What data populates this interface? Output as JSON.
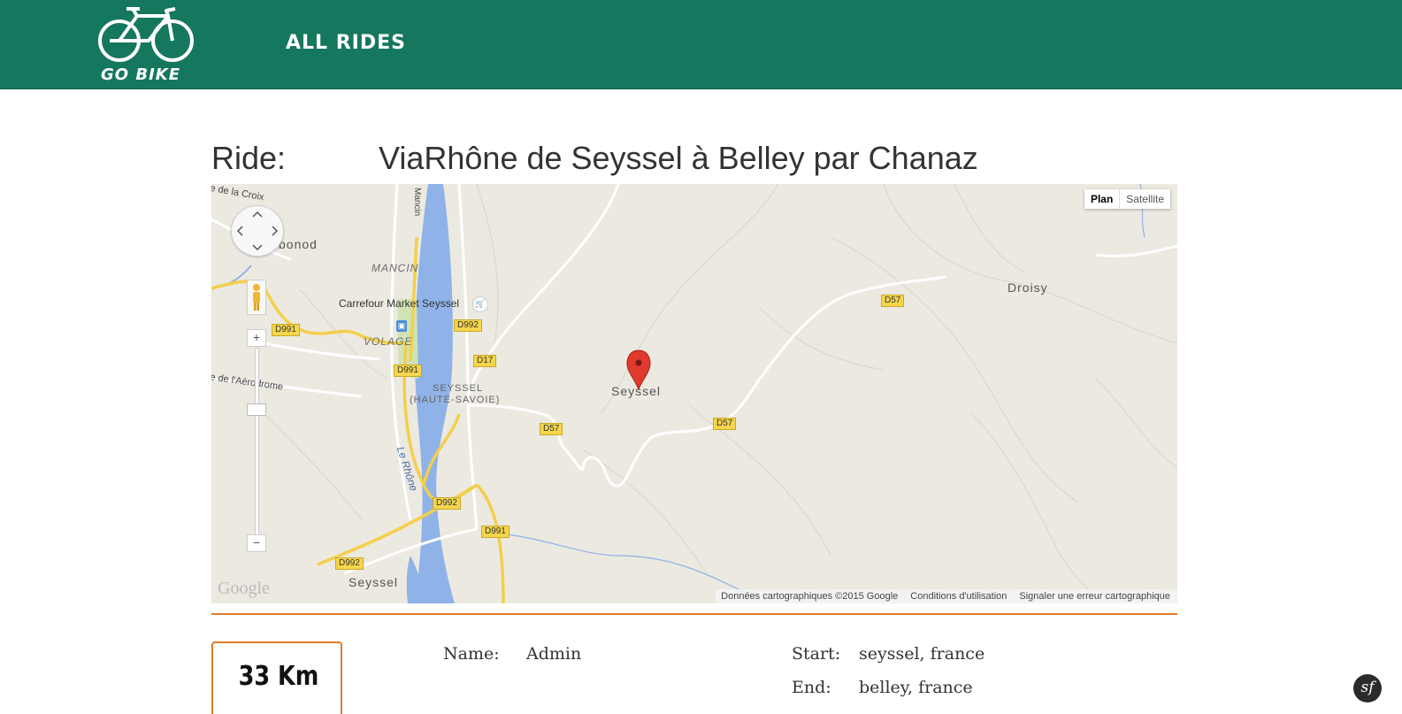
{
  "header": {
    "logo_text": "GO BIKE",
    "nav_all_rides": "ALL RIDES",
    "bg_color": "#15775e"
  },
  "ride": {
    "label": "Ride:",
    "title": "ViaRhône de Seyssel à Belley par Chanaz"
  },
  "map": {
    "map_type": {
      "plan": "Plan",
      "satellite": "Satellite"
    },
    "places": {
      "seyssel_center": "Seyssel",
      "droisy": "Droisy",
      "mancin": "MANCIN",
      "carrefour": "Carrefour Market Seyssel",
      "volage": "VOLAGE",
      "seyssel_hs_1": "SEYSSEL",
      "seyssel_hs_2": "(HAUTE-SAVOIE)",
      "le_rhone": "Le Rhône",
      "aerodrome": "e de l'Aérodrome",
      "croix": "e de la Croix",
      "bonod": "bonod",
      "mancin_road": "Mancin",
      "seyssel_bottom": "Seyssel"
    },
    "roads": {
      "d991_a": "D991",
      "d991_b": "D991",
      "d991_c": "D991",
      "d992_a": "D992",
      "d992_b": "D992",
      "d992_c": "D992",
      "d17": "D17",
      "d57_a": "D57",
      "d57_b": "D57",
      "d57_c": "D57"
    },
    "attribution": {
      "data": "Données cartographiques ©2015 Google",
      "terms": "Conditions d'utilisation",
      "report": "Signaler une erreur cartographique"
    },
    "google_logo": "Google",
    "marker_color": "#e03a2e"
  },
  "stats": {
    "distance": "33 Km",
    "name_label": "Name:",
    "name_value": "Admin",
    "start_label": "Start:",
    "start_value": "seyssel, france",
    "end_label": "End:",
    "end_value": "belley, france"
  },
  "symfony_badge": "sf",
  "accent_color": "#e07b2a"
}
